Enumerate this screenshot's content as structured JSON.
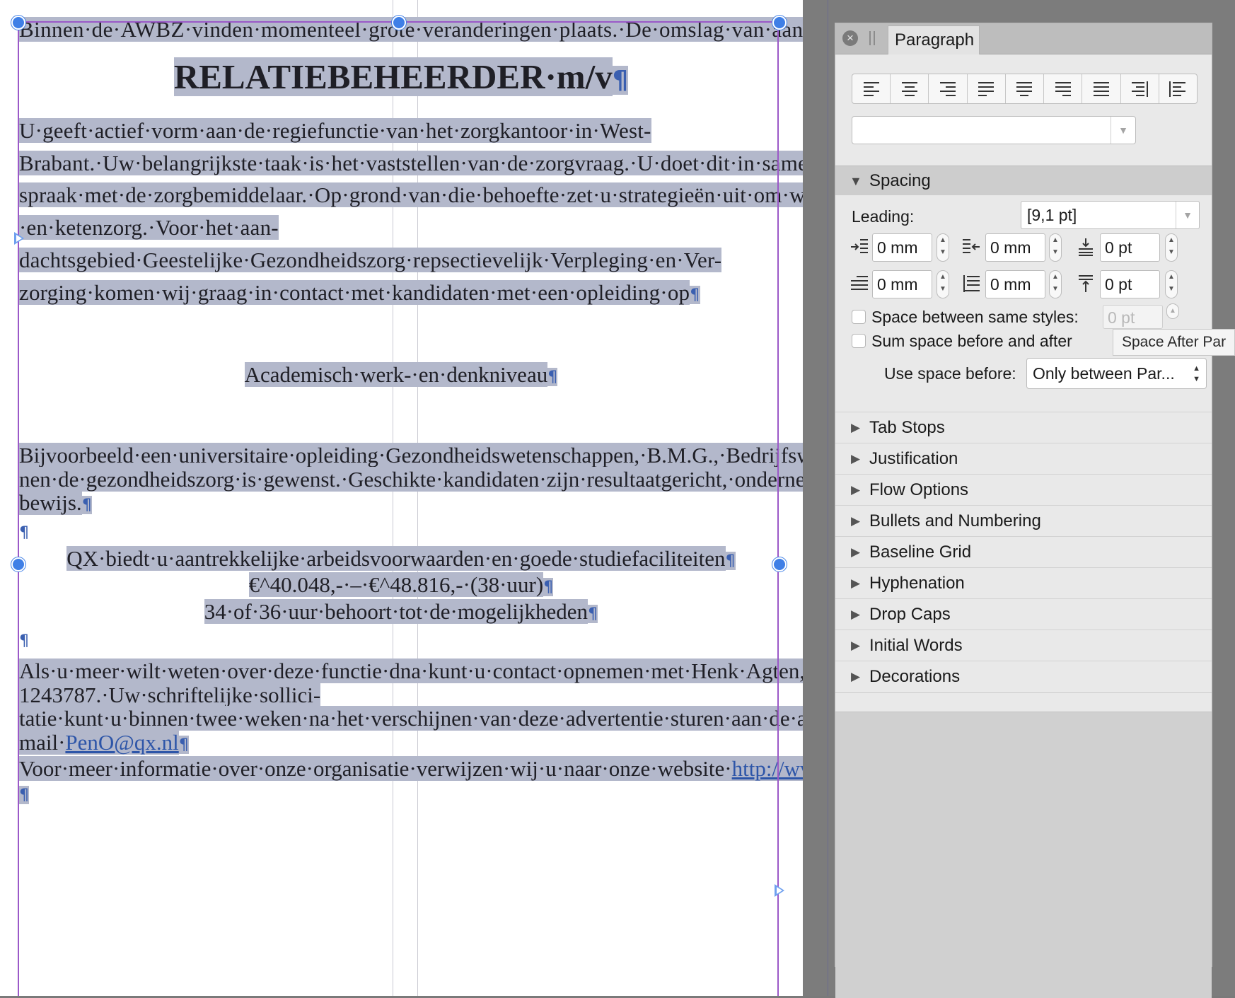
{
  "document": {
    "intro": "Binnen·de·AWBZ·vinden·momenteel·grote·veranderingen·plaats.·De·omslag·van·aanbodsturing··naar·een·vraaggericht·zorgaanbod·is·de·belangrijkste.·Het·zorgkantoor·neemt·de·zorgvraag·als·uitgangspunt·voor·de·zorginkoop.·Voor·deze·taak·zijn·wij·op·zoek·naar·twee·medewerkers·in·de·funktie·van",
    "heading": "RELATIEBEHEERDER·m/v",
    "body1": "U·geeft·actief·vorm·aan·de·regiefunctie·van·het·zorgkantoor·in·West-Brabant.·Uw·belangrijkste·taak·is·het·vaststellen·van·de·zorgvraag.·U·doet·dit·in·samen-spraak·met·de·zorgbemiddelaar.·Op·grond·van·die·behoefte·zet·u·strategieën·uit·om·wachttijden·en·wachtlijsten·in·de·regio·terug·te·dringen.·U·maakt·hiervoor·passende·afspraken·met·zorgverleners.·U·toetst·het·beleid·van·de·instellingen·aan·de·regiovisies·en·stimuleert·de·transmurale-·en·ketenzorg.·Voor·het·aan-dachtsgebied·Geestelijke·Gezondheidszorg·repsectievelijk·Verpleging·en·Ver-zorging·komen·wij·graag·in·contact·met·kandidaten·met·een·opleiding·op",
    "level": "Academisch·werk-·en·denkniveau",
    "body2": "Bijvoorbeeld·een·universitaire·opleiding·Gezondheidswetenschappen,·B.M.G.,·Bedrijfswetenschappen.·Enkele·jaren·ervaring·in·een·beleidsmatige·functie·bin-nen·de·gezondheidszorg·is·gewenst.·Geschikte·kandidaten·zijn·resultaatgericht,·ondernemend·en·beschikken·over·uitstekende·communicatieve·vaardigheden.·U·bent·besluitvaardig·en·weet·sensitiviteit·voor·meerdere·belangen·aan·de·dag·te·leggen.·U·werkt·zelfstandig·en·in·teamverband.·U·bent·in·het·bezit·van·een·rij-bewijs.",
    "offer_line1": "QX·biedt·u·aantrekkelijke·arbeidsvoorwaarden·en·goede·studiefaciliteiten",
    "offer_line2": "€^40.048,-·–·€^48.816,-·(38·uur)",
    "offer_line3": "34·of·36·uur·behoort·tot·de·mogelijkheden",
    "contact": "Als·u·meer·wilt·weten·over·deze·functie·dna·kunt·u·contact·opnemen·met·Henk·Agten,·manager·zorgkantoren,·telefoon·076-1243787.·Uw·schriftelijke·sollici-tatie·kunt·u·binnen·twee·weken·na·het·verschijnen·van·deze·advertentie·sturen·aan·de·afdeling·Personeel·&·Organisatie·t.a.v.·Lia·de·Praal,·manager·P&O,·Chasséveld·17,·4811·DH·Breda·of·per·e-mail·",
    "email": "PenO@qx.nl",
    "website_line": "Voor·meer·informatie·over·onze·organisatie·verwijzen·wij·u·naar·onze·website·",
    "website": "http://www.qx.nl/",
    "pilcrow": "¶"
  },
  "panel": {
    "tab_label": "Paragraph",
    "close_icon": "×",
    "alignment_buttons": [
      {
        "name": "align-left"
      },
      {
        "name": "align-center"
      },
      {
        "name": "align-right"
      },
      {
        "name": "justify-left"
      },
      {
        "name": "justify-center"
      },
      {
        "name": "justify-right"
      },
      {
        "name": "justify-all"
      },
      {
        "name": "align-towards-spine"
      },
      {
        "name": "align-away-from-spine"
      }
    ],
    "paragraph_style_value": "",
    "spacing": {
      "title": "Spacing",
      "leading_label": "Leading:",
      "leading_value": "[9,1 pt]",
      "left_indent": "0 mm",
      "right_indent": "0 mm",
      "space_before": "0 pt",
      "first_line_indent": "0 mm",
      "last_line_indent": "0 mm",
      "space_after": "0 pt",
      "space_between_same_styles_label": "Space between same styles:",
      "space_between_same_styles_value": "0 pt",
      "sum_space_label": "Sum space before and after",
      "use_space_before_label": "Use space before:",
      "use_space_before_value": "Only between Par...",
      "tooltip": "Space After Par"
    },
    "sections": [
      "Tab Stops",
      "Justification",
      "Flow Options",
      "Bullets and Numbering",
      "Baseline Grid",
      "Hyphenation",
      "Drop Caps",
      "Initial Words",
      "Decorations"
    ]
  },
  "colors": {
    "selection": "#b3b8cb",
    "frame": "#9b59c8",
    "handle": "#3f7fe6",
    "pilcrow": "#3a5fb0"
  }
}
